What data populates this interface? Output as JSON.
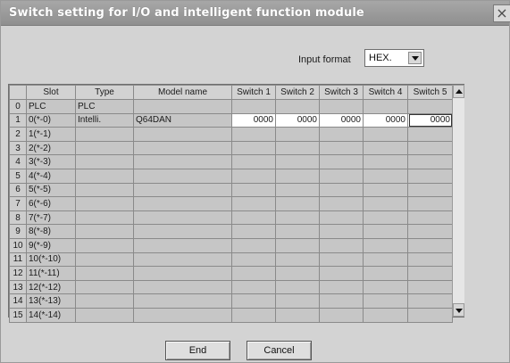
{
  "window": {
    "title": "Switch setting for I/O and intelligent function module",
    "close_glyph": "×"
  },
  "input_format": {
    "label": "Input format",
    "selected": "HEX."
  },
  "table": {
    "headers": [
      "",
      "Slot",
      "Type",
      "Model name",
      "Switch 1",
      "Switch 2",
      "Switch 3",
      "Switch 4",
      "Switch 5"
    ],
    "rows": [
      {
        "num": "0",
        "slot": "PLC",
        "type": "PLC",
        "model": "",
        "switches": [
          "",
          "",
          "",
          "",
          ""
        ]
      },
      {
        "num": "1",
        "slot": "0(*-0)",
        "type": "Intelli.",
        "model": "Q64DAN",
        "switches": [
          "0000",
          "0000",
          "0000",
          "0000",
          "0000"
        ]
      },
      {
        "num": "2",
        "slot": "1(*-1)",
        "type": "",
        "model": "",
        "switches": [
          "",
          "",
          "",
          "",
          ""
        ]
      },
      {
        "num": "3",
        "slot": "2(*-2)",
        "type": "",
        "model": "",
        "switches": [
          "",
          "",
          "",
          "",
          ""
        ]
      },
      {
        "num": "4",
        "slot": "3(*-3)",
        "type": "",
        "model": "",
        "switches": [
          "",
          "",
          "",
          "",
          ""
        ]
      },
      {
        "num": "5",
        "slot": "4(*-4)",
        "type": "",
        "model": "",
        "switches": [
          "",
          "",
          "",
          "",
          ""
        ]
      },
      {
        "num": "6",
        "slot": "5(*-5)",
        "type": "",
        "model": "",
        "switches": [
          "",
          "",
          "",
          "",
          ""
        ]
      },
      {
        "num": "7",
        "slot": "6(*-6)",
        "type": "",
        "model": "",
        "switches": [
          "",
          "",
          "",
          "",
          ""
        ]
      },
      {
        "num": "8",
        "slot": "7(*-7)",
        "type": "",
        "model": "",
        "switches": [
          "",
          "",
          "",
          "",
          ""
        ]
      },
      {
        "num": "9",
        "slot": "8(*-8)",
        "type": "",
        "model": "",
        "switches": [
          "",
          "",
          "",
          "",
          ""
        ]
      },
      {
        "num": "10",
        "slot": "9(*-9)",
        "type": "",
        "model": "",
        "switches": [
          "",
          "",
          "",
          "",
          ""
        ]
      },
      {
        "num": "11",
        "slot": "10(*-10)",
        "type": "",
        "model": "",
        "switches": [
          "",
          "",
          "",
          "",
          ""
        ]
      },
      {
        "num": "12",
        "slot": "11(*-11)",
        "type": "",
        "model": "",
        "switches": [
          "",
          "",
          "",
          "",
          ""
        ]
      },
      {
        "num": "13",
        "slot": "12(*-12)",
        "type": "",
        "model": "",
        "switches": [
          "",
          "",
          "",
          "",
          ""
        ]
      },
      {
        "num": "14",
        "slot": "13(*-13)",
        "type": "",
        "model": "",
        "switches": [
          "",
          "",
          "",
          "",
          ""
        ]
      },
      {
        "num": "15",
        "slot": "14(*-14)",
        "type": "",
        "model": "",
        "switches": [
          "",
          "",
          "",
          "",
          ""
        ]
      }
    ]
  },
  "buttons": {
    "end_label": "End",
    "cancel_label": "Cancel"
  },
  "icons": {
    "close": "close-icon",
    "dropdown": "chevron-down-icon",
    "scroll_up": "arrow-up-icon",
    "scroll_down": "arrow-down-icon"
  }
}
